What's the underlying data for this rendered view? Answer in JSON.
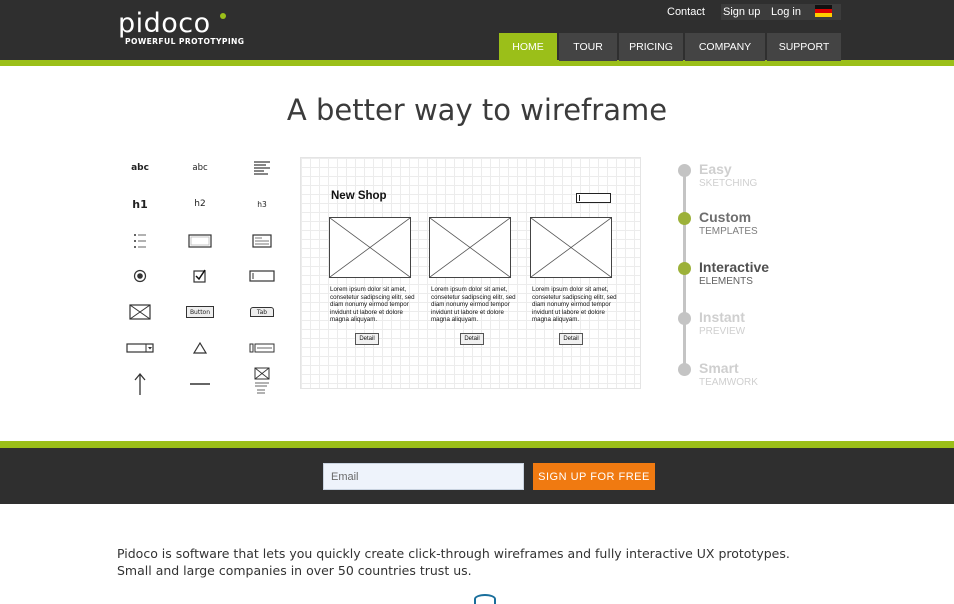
{
  "header": {
    "logo_text": "pidoco",
    "logo_tagline": "POWERFUL PROTOTYPING",
    "top_links": {
      "contact": "Contact",
      "signup": "Sign up",
      "login": "Log in"
    },
    "language_flag": "germany-flag-icon",
    "nav": [
      {
        "label": "HOME",
        "active": true
      },
      {
        "label": "TOUR",
        "active": false
      },
      {
        "label": "PRICING",
        "active": false
      },
      {
        "label": "COMPANY",
        "active": false
      },
      {
        "label": "SUPPORT",
        "active": false
      }
    ]
  },
  "hero": {
    "title": "A better way to wireframe"
  },
  "palette": {
    "labels": {
      "abc1": "abc",
      "abc2": "abc",
      "h1": "h1",
      "h2": "h2",
      "h3": "h3",
      "button": "Button",
      "tab": "Tab"
    },
    "icons": [
      "text-icon",
      "text-small-icon",
      "paragraph-icon",
      "h1-icon",
      "h2-icon",
      "h3-icon",
      "list-icon",
      "input-box-icon",
      "card-icon",
      "radio-icon",
      "checkbox-icon",
      "textfield-icon",
      "image-placeholder-icon",
      "button-icon",
      "tab-icon",
      "dropdown-icon",
      "triangle-icon",
      "slider-icon",
      "arrow-up-icon",
      "line-icon",
      "page-icon"
    ]
  },
  "mockup": {
    "shop_title": "New Shop",
    "products": [
      {
        "text": "Lorem ipsum dolor sit amet, consetetur sadipscing elitr, sed diam nonumy eirmod tempor invidunt ut labore et dolore magna aliquyam.",
        "button": "Detail"
      },
      {
        "text": "Lorem ipsum dolor sit amet, consetetur sadipscing elitr, sed diam nonumy eirmod tempor invidunt ut labore et dolore magna aliquyam.",
        "button": "Detail"
      },
      {
        "text": "Lorem ipsum dolor sit amet, consetetur sadipscing elitr, sed diam nonumy eirmod tempor invidunt ut labore et dolore magna aliquyam.",
        "button": "Detail"
      }
    ]
  },
  "steps": [
    {
      "title": "Easy",
      "subtitle": "SKETCHING",
      "state": "inactive"
    },
    {
      "title": "Custom",
      "subtitle": "TEMPLATES",
      "state": "done"
    },
    {
      "title": "Interactive",
      "subtitle": "ELEMENTS",
      "state": "current"
    },
    {
      "title": "Instant",
      "subtitle": "PREVIEW",
      "state": "inactive"
    },
    {
      "title": "Smart",
      "subtitle": "TEAMWORK",
      "state": "inactive"
    }
  ],
  "signup": {
    "email_placeholder": "Email",
    "button_label": "SIGN UP FOR FREE"
  },
  "about": {
    "line1": "Pidoco is software that lets you quickly create click-through wireframes and fully interactive UX prototypes.",
    "line2": "Small and large companies in over 50 countries trust us."
  },
  "colors": {
    "header_bg": "#2f2f2f",
    "accent_green": "#9bbf19",
    "signup_orange": "#f07a11",
    "text_dark": "#3b3b3b"
  }
}
